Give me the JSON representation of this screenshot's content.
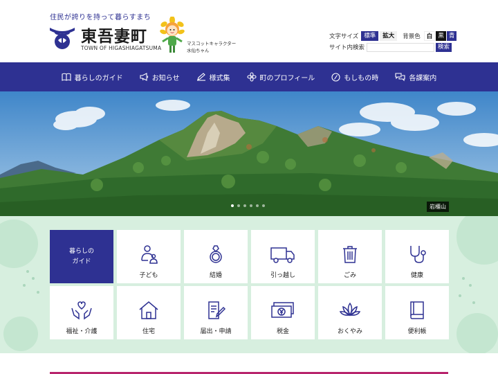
{
  "header": {
    "tagline": "住民が誇りを持って暮らすまち",
    "town_name": "東吾妻町",
    "town_roman": "TOWN OF HIGASHIAGATSUMA",
    "mascot_caption_1": "マスコットキャラクター",
    "mascot_caption_2": "水仙ちゃん"
  },
  "tools": {
    "font_size_label": "文字サイズ",
    "standard_label": "標準",
    "large_label": "拡大",
    "bg_color_label": "背景色",
    "bg_white": "白",
    "bg_black": "黒",
    "bg_blue": "青",
    "search_label": "サイト内検索",
    "search_placeholder": "",
    "search_button": "検索"
  },
  "nav": {
    "items": [
      {
        "label": "暮らしのガイド",
        "icon": "book-icon"
      },
      {
        "label": "お知らせ",
        "icon": "megaphone-icon"
      },
      {
        "label": "様式集",
        "icon": "pen-icon"
      },
      {
        "label": "町のプロフィール",
        "icon": "flower-icon"
      },
      {
        "label": "もしもの時",
        "icon": "slash-circle-icon"
      },
      {
        "label": "各課案内",
        "icon": "chat-icon"
      }
    ]
  },
  "hero": {
    "caption": "岩櫃山",
    "slide_count": 6,
    "active_slide": 1
  },
  "guide": {
    "title": "暮らしの\nガイド",
    "tiles": [
      {
        "label": "子ども",
        "icon": "parent-child-icon"
      },
      {
        "label": "結婚",
        "icon": "ring-icon"
      },
      {
        "label": "引っ越し",
        "icon": "truck-icon"
      },
      {
        "label": "ごみ",
        "icon": "trash-icon"
      },
      {
        "label": "健康",
        "icon": "stethoscope-icon"
      },
      {
        "label": "福祉・介護",
        "icon": "hands-heart-icon"
      },
      {
        "label": "住宅",
        "icon": "house-icon"
      },
      {
        "label": "届出・申請",
        "icon": "document-pen-icon"
      },
      {
        "label": "税金",
        "icon": "yen-banknote-icon"
      },
      {
        "label": "おくやみ",
        "icon": "lotus-icon"
      },
      {
        "label": "便利帳",
        "icon": "handbook-icon"
      }
    ]
  },
  "colors": {
    "primary": "#2e3192",
    "guide_bg": "#d7efdf",
    "accent_line": "#b8246d"
  }
}
